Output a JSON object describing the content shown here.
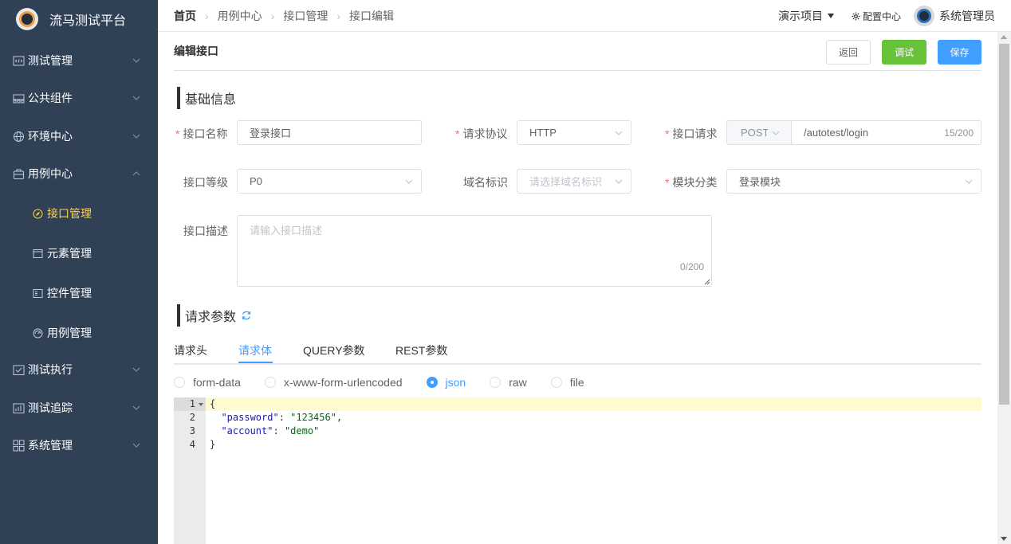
{
  "app": {
    "title": "流马测试平台"
  },
  "sidebar": {
    "items": [
      {
        "label": "测试管理",
        "icon": "code-icon"
      },
      {
        "label": "公共组件",
        "icon": "component-icon"
      },
      {
        "label": "环境中心",
        "icon": "globe-icon"
      },
      {
        "label": "用例中心",
        "icon": "box-icon"
      },
      {
        "label": "测试执行",
        "icon": "checklist-icon"
      },
      {
        "label": "测试追踪",
        "icon": "chart-icon"
      },
      {
        "label": "系统管理",
        "icon": "grid-icon"
      }
    ],
    "submenu": [
      {
        "label": "接口管理",
        "icon": "compass-icon"
      },
      {
        "label": "元素管理",
        "icon": "window-icon"
      },
      {
        "label": "控件管理",
        "icon": "form-icon"
      },
      {
        "label": "用例管理",
        "icon": "gauge-icon"
      }
    ],
    "active_color": "#ffd04b"
  },
  "header": {
    "breadcrumb": [
      "首页",
      "用例中心",
      "接口管理",
      "接口编辑"
    ],
    "project": "演示项目",
    "config": "配置中心",
    "user": "系统管理员"
  },
  "page": {
    "title": "编辑接口",
    "buttons": {
      "back": "返回",
      "debug": "调试",
      "save": "保存"
    }
  },
  "basic": {
    "section_title": "基础信息",
    "name": {
      "label": "接口名称",
      "value": "登录接口"
    },
    "protocol": {
      "label": "请求协议",
      "value": "HTTP"
    },
    "request": {
      "label": "接口请求",
      "method": "POST",
      "path": "/autotest/login",
      "count": "15/200"
    },
    "level": {
      "label": "接口等级",
      "value": "P0"
    },
    "domain": {
      "label": "域名标识",
      "placeholder": "请选择域名标识"
    },
    "module": {
      "label": "模块分类",
      "value": "登录模块"
    },
    "desc": {
      "label": "接口描述",
      "placeholder": "请输入接口描述",
      "count": "0/200"
    }
  },
  "params": {
    "section_title": "请求参数",
    "tabs": [
      "请求头",
      "请求体",
      "QUERY参数",
      "REST参数"
    ],
    "active_tab": "请求体",
    "body_types": [
      "form-data",
      "x-www-form-urlencoded",
      "json",
      "raw",
      "file"
    ],
    "selected_body_type": "json"
  },
  "editor": {
    "lines": [
      {
        "num": "1",
        "text": "{"
      },
      {
        "num": "2",
        "key": "\"password\"",
        "sep": ": ",
        "value": "\"123456\"",
        "end": ","
      },
      {
        "num": "3",
        "key": "\"account\"",
        "sep": ": ",
        "value": "\"demo\"",
        "end": ""
      },
      {
        "num": "4",
        "text": "}"
      }
    ]
  }
}
